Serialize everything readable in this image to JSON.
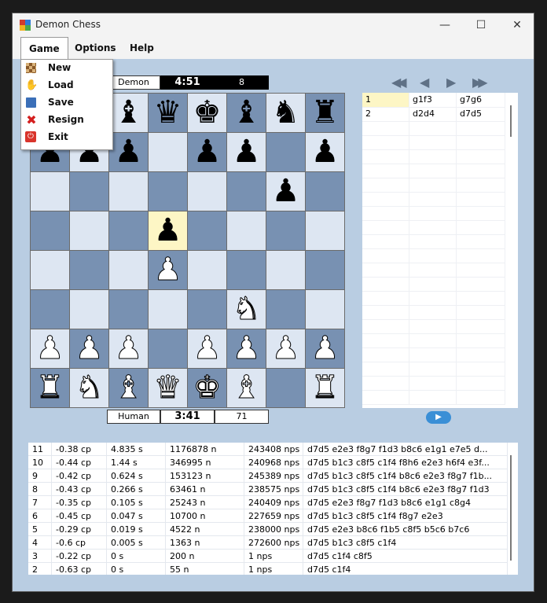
{
  "window": {
    "title": "Demon Chess",
    "minimize_glyph": "—",
    "maximize_glyph": "☐",
    "close_glyph": "✕"
  },
  "menubar": {
    "items": [
      "Game",
      "Options",
      "Help"
    ]
  },
  "game_menu": [
    {
      "label": "New",
      "icon": "board-icon"
    },
    {
      "label": "Load",
      "icon": "load-icon"
    },
    {
      "label": "Save",
      "icon": "save-icon"
    },
    {
      "label": "Resign",
      "icon": "resign-icon"
    },
    {
      "label": "Exit",
      "icon": "exit-icon"
    }
  ],
  "top_player": {
    "name": "Demon",
    "clock": "4:51",
    "count": "8"
  },
  "bottom_player": {
    "name": "Human",
    "clock": "3:41",
    "count": "71"
  },
  "board": {
    "rows": [
      "rnbqkbnr",
      "ppp.pp.p",
      "......p.",
      "...p....",
      "...P....",
      ".....N..",
      "PPP.PPPP",
      "RNBQKB.R"
    ],
    "highlight": [
      [
        3,
        3
      ]
    ],
    "colors": {
      "light": "#dde6f2",
      "dark": "#7891b2",
      "highlight": "#fdf6c5"
    }
  },
  "navigation": [
    "first-move-icon",
    "previous-move-icon",
    "next-move-icon",
    "last-move-icon"
  ],
  "moves": [
    {
      "num": "1",
      "white": "g1f3",
      "black": "g7g6"
    },
    {
      "num": "2",
      "white": "d2d4",
      "black": "d7d5"
    }
  ],
  "analysis": [
    {
      "depth": "11",
      "score": "-0.38 cp",
      "time": "4.835 s",
      "nodes": "1176878 n",
      "nps": "243408 nps",
      "pv": "d7d5 e2e3 f8g7 f1d3 b8c6 e1g1 e7e5 d..."
    },
    {
      "depth": "10",
      "score": "-0.44 cp",
      "time": "1.44 s",
      "nodes": "346995 n",
      "nps": "240968 nps",
      "pv": "d7d5 b1c3 c8f5 c1f4 f8h6 e2e3 h6f4 e3f..."
    },
    {
      "depth": "9",
      "score": "-0.42 cp",
      "time": "0.624 s",
      "nodes": "153123 n",
      "nps": "245389 nps",
      "pv": "d7d5 b1c3 c8f5 c1f4 b8c6 e2e3 f8g7 f1b..."
    },
    {
      "depth": "8",
      "score": "-0.43 cp",
      "time": "0.266 s",
      "nodes": "63461 n",
      "nps": "238575 nps",
      "pv": "d7d5 b1c3 c8f5 c1f4 b8c6 e2e3 f8g7 f1d3"
    },
    {
      "depth": "7",
      "score": "-0.35 cp",
      "time": "0.105 s",
      "nodes": "25243 n",
      "nps": "240409 nps",
      "pv": "d7d5 e2e3 f8g7 f1d3 b8c6 e1g1 c8g4"
    },
    {
      "depth": "6",
      "score": "-0.45 cp",
      "time": "0.047 s",
      "nodes": "10700 n",
      "nps": "227659 nps",
      "pv": "d7d5 b1c3 c8f5 c1f4 f8g7 e2e3"
    },
    {
      "depth": "5",
      "score": "-0.29 cp",
      "time": "0.019 s",
      "nodes": "4522 n",
      "nps": "238000 nps",
      "pv": "d7d5 e2e3 b8c6 f1b5 c8f5 b5c6 b7c6"
    },
    {
      "depth": "4",
      "score": "-0.6 cp",
      "time": "0.005 s",
      "nodes": "1363 n",
      "nps": "272600 nps",
      "pv": "d7d5 b1c3 c8f5 c1f4"
    },
    {
      "depth": "3",
      "score": "-0.22 cp",
      "time": "0 s",
      "nodes": "200 n",
      "nps": "1 nps",
      "pv": "d7d5 c1f4 c8f5"
    },
    {
      "depth": "2",
      "score": "-0.63 cp",
      "time": "0 s",
      "nodes": "55 n",
      "nps": "1 nps",
      "pv": "d7d5 c1f4"
    }
  ]
}
